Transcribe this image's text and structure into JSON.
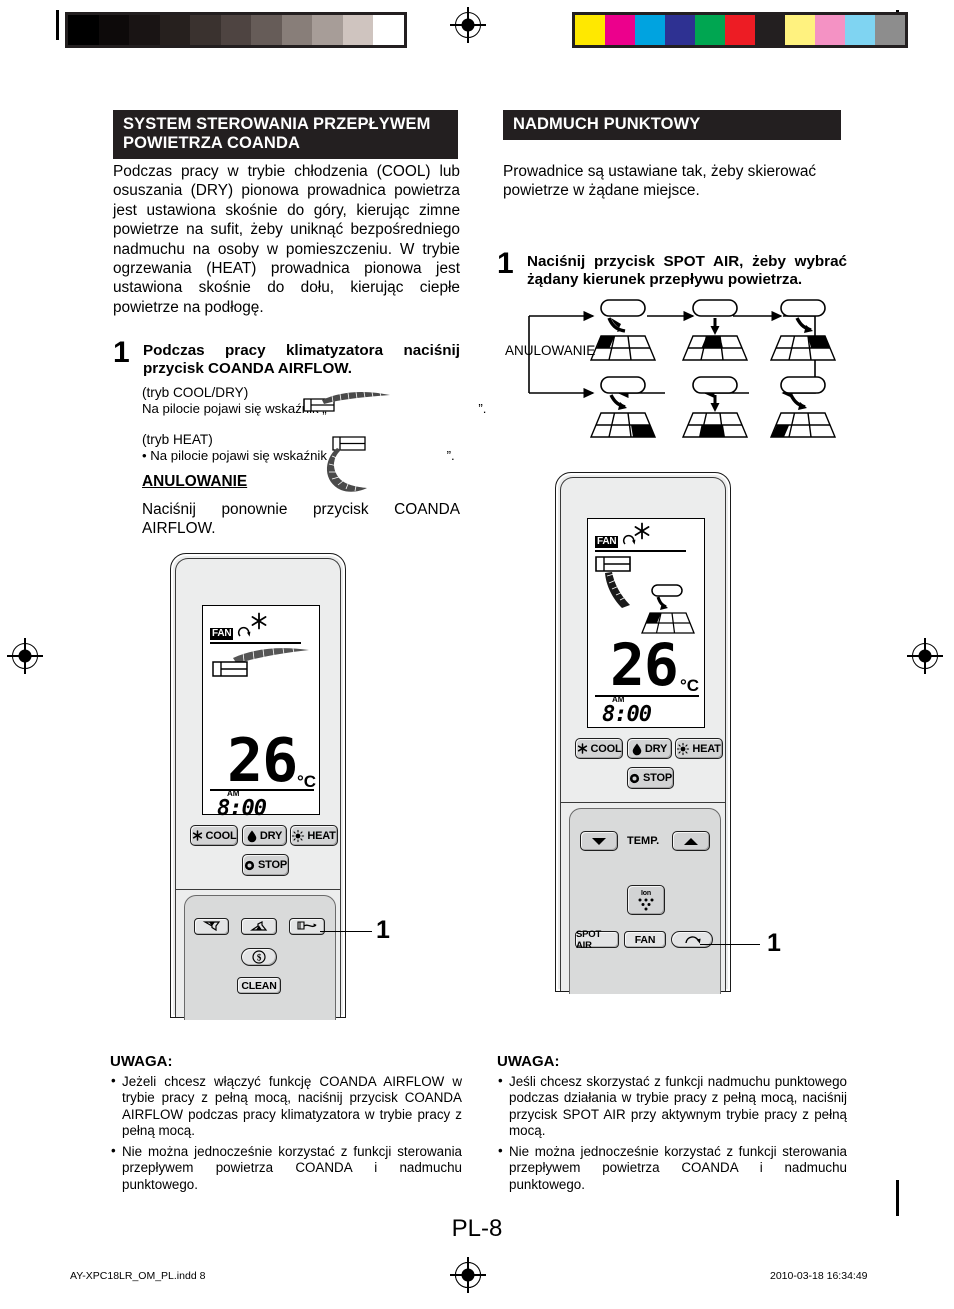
{
  "page": {
    "number_label": "PL-8",
    "footer_file": "AY-XPC18LR_OM_PL.indd   8",
    "footer_timestamp": "2010-03-18   16:34:49"
  },
  "calibration": {
    "gray_bar_name": "grayscale-step-wedge",
    "gray_swatches": [
      "#000000",
      "#0d0a0a",
      "#191414",
      "#26201e",
      "#3a322f",
      "#4e4441",
      "#665c58",
      "#887e79",
      "#a79d98",
      "#cfc4bf",
      "#ffffff"
    ],
    "color_swatches": [
      "#ffe800",
      "#ec008c",
      "#00a3e0",
      "#2e3192",
      "#00a651",
      "#ed1c24",
      "#231f20",
      "#fff27f",
      "#f492c4",
      "#7fd4f2",
      "#8d8d8d"
    ]
  },
  "left_column": {
    "header": "SYSTEM STEROWANIA PRZEPŁYWEM POWIETRZA COANDA",
    "intro": "Podczas pracy w trybie chłodzenia (COOL) lub osuszania (DRY) pionowa prowadnica powietrza jest ustawiona skośnie do góry, kierując zimne powietrze na sufit, żeby uniknąć bezpośredniego nadmuchu na osoby w pomieszczeniu. W trybie ogrzewania (HEAT) prowadnica pionowa jest ustawiona skośnie do dołu, kierując ciepłe powietrze na podłogę.",
    "step": {
      "number": "1",
      "text": "Podczas pracy klimatyzatora naciśnij przycisk COANDA AIRFLOW.",
      "mode_cool_label": "(tryb COOL/DRY)",
      "mode_cool_text_before": "Na pilocie pojawi się wskaźnik „",
      "mode_cool_text_after": "”.",
      "mode_heat_label": "(tryb HEAT)",
      "mode_heat_text_before": "• Na pilocie pojawi się wskaźnik „",
      "mode_heat_text_after": "”."
    },
    "cancel_heading": "ANULOWANIE",
    "cancel_text": "Naciśnij ponownie przycisk COANDA AIRFLOW.",
    "note": {
      "title": "UWAGA:",
      "bullet_char": "•",
      "items": [
        "Jeżeli chcesz włączyć funkcję COANDA AIRFLOW w trybie pracy z pełną mocą, naciśnij przycisk COANDA AIRFLOW podczas pracy klimatyzatora w trybie pracy z pełną mocą.",
        "Nie można jednocześnie korzystać z funkcji sterowania przepływem powietrza COANDA i nadmuchu punktowego."
      ]
    },
    "remote": {
      "callout_number": "1",
      "lcd": {
        "fan_label": "FAN",
        "temperature": "26",
        "unit": "°C",
        "am_label": "AM",
        "clock": "8:00",
        "snowflake_icon": "snowflake-icon",
        "swing_icon": "swing-arrow-icon",
        "coanda_icon": "coanda-airflow-up-icon"
      },
      "buttons": [
        {
          "name": "cool-button",
          "label": "COOL",
          "icon": "snowflake-icon"
        },
        {
          "name": "dry-button",
          "label": "DRY",
          "icon": "water-drop-icon"
        },
        {
          "name": "heat-button",
          "label": "HEAT",
          "icon": "sun-icon"
        },
        {
          "name": "stop-button",
          "label": "STOP",
          "icon": "circle-icon"
        },
        {
          "name": "air-direction-down-button",
          "label": "",
          "icon": "airflow-down-icon"
        },
        {
          "name": "air-direction-up-button",
          "label": "",
          "icon": "airflow-up-icon"
        },
        {
          "name": "coanda-airflow-button",
          "label": "",
          "icon": "coanda-airflow-icon"
        },
        {
          "name": "eco-button",
          "label": "",
          "icon": "dollar-icon"
        },
        {
          "name": "clean-button",
          "label": "CLEAN",
          "icon": ""
        }
      ]
    }
  },
  "right_column": {
    "header": "NADMUCH PUNKTOWY",
    "intro": "Prowadnice są ustawiane tak, żeby skierować powietrze w żądane miejsce.",
    "step": {
      "number": "1",
      "text": "Naciśnij przycisk SPOT AIR, żeby wybrać żądany kierunek przepływu powietrza."
    },
    "diagram": {
      "cancel_label": "ANULOWANIE",
      "cells": [
        {
          "position": 1,
          "highlight": "left-far",
          "arrow": "curve-left"
        },
        {
          "position": 2,
          "highlight": "center-far",
          "arrow": "straight-down"
        },
        {
          "position": 3,
          "highlight": "right-far",
          "arrow": "curve-right"
        },
        {
          "position": 4,
          "highlight": "left-near",
          "arrow": "curve-left"
        },
        {
          "position": 5,
          "highlight": "center-near",
          "arrow": "straight-down"
        },
        {
          "position": 6,
          "highlight": "right-near",
          "arrow": "curve-left"
        }
      ]
    },
    "note": {
      "title": "UWAGA:",
      "bullet_char": "•",
      "items": [
        "Jeśli chcesz skorzystać z funkcji nadmuchu punktowego podczas działania w trybie pracy z pełną mocą, naciśnij przycisk SPOT AIR przy aktywnym trybie pracy z pełną mocą.",
        "Nie można jednocześnie korzystać z funkcji sterowania przepływem powietrza COANDA i nadmuchu punktowego."
      ]
    },
    "remote": {
      "callout_number": "1",
      "lcd": {
        "fan_label": "FAN",
        "temperature": "26",
        "unit": "°C",
        "am_label": "AM",
        "clock": "8:00",
        "snowflake_icon": "snowflake-icon",
        "swing_icon": "swing-arrow-icon",
        "spot_air_icon": "spot-air-grid-icon"
      },
      "buttons": [
        {
          "name": "cool-button",
          "label": "COOL",
          "icon": "snowflake-icon"
        },
        {
          "name": "dry-button",
          "label": "DRY",
          "icon": "water-drop-icon"
        },
        {
          "name": "heat-button",
          "label": "HEAT",
          "icon": "sun-icon"
        },
        {
          "name": "stop-button",
          "label": "STOP",
          "icon": "circle-icon"
        },
        {
          "name": "temp-down-button",
          "label": "",
          "icon": "triangle-down-icon"
        },
        {
          "name": "temp-label",
          "label": "TEMP.",
          "icon": ""
        },
        {
          "name": "temp-up-button",
          "label": "",
          "icon": "triangle-up-icon"
        },
        {
          "name": "ion-button",
          "label": "Ion",
          "icon": "ion-dots-icon"
        },
        {
          "name": "spot-air-button",
          "label": "SPOT AIR",
          "icon": ""
        },
        {
          "name": "fan-button",
          "label": "FAN",
          "icon": ""
        },
        {
          "name": "swing-button",
          "label": "",
          "icon": "swing-arrow-icon"
        }
      ]
    }
  }
}
